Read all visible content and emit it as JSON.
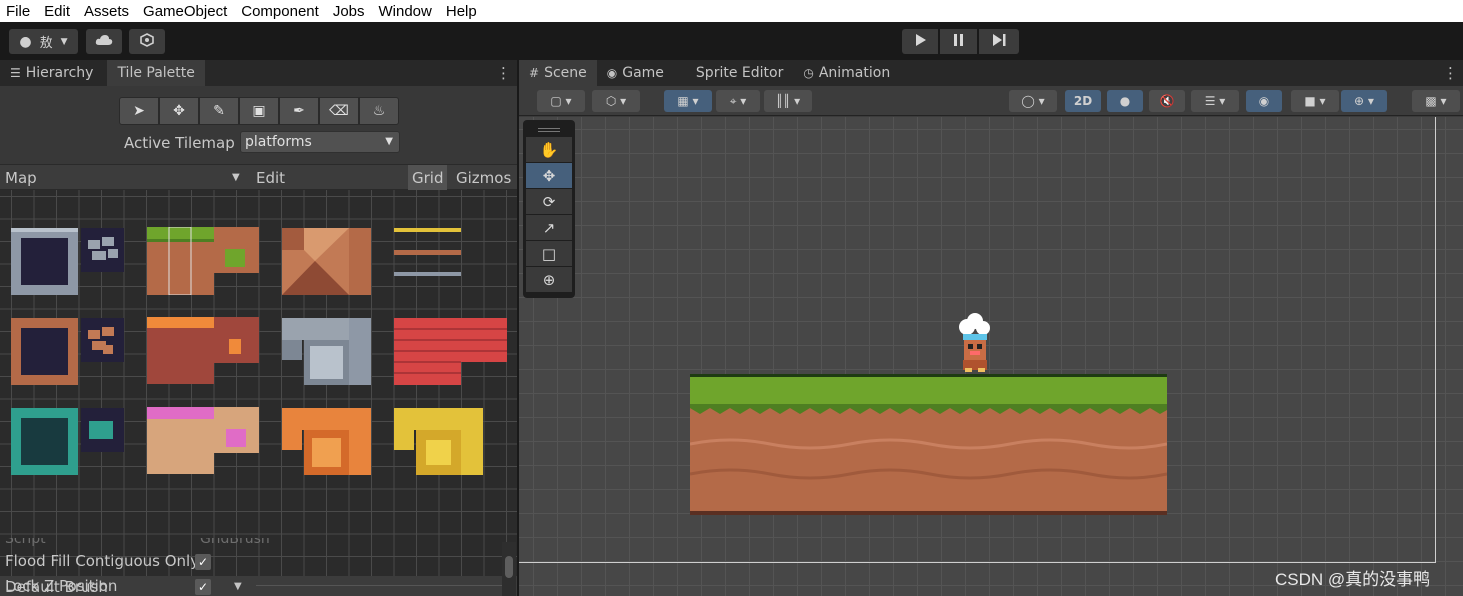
{
  "menu": [
    "File",
    "Edit",
    "Assets",
    "GameObject",
    "Component",
    "Jobs",
    "Window",
    "Help"
  ],
  "toolbar": {
    "account_label": "敖",
    "play_icon": "play-icon",
    "pause_icon": "pause-icon",
    "step_icon": "step-icon"
  },
  "left_tabs": [
    "Hierarchy",
    "Tile Palette"
  ],
  "palette": {
    "active_tilemap_label": "Active Tilemap",
    "active_tilemap_value": "platforms",
    "map_label": "Map",
    "edit_label": "Edit",
    "grid_label": "Grid",
    "gizmos_label": "Gizmos",
    "brush_label": "Default Brush",
    "script_label": "Script",
    "script_value": "GridBrush",
    "props": [
      {
        "label": "Flood Fill Contiguous Only",
        "checked": "✓"
      },
      {
        "label": "Lock Z Position",
        "checked": "✓"
      }
    ]
  },
  "scene_tabs": [
    "Scene",
    "Game",
    "Sprite Editor",
    "Animation"
  ],
  "scene_toolbar": {
    "mode_2d": "2D"
  },
  "colors": {
    "grass": "#6fa52c",
    "dirt": "#b46a48",
    "selection_blue": "#46607c"
  },
  "watermark": "CSDN @真的没事鸭"
}
